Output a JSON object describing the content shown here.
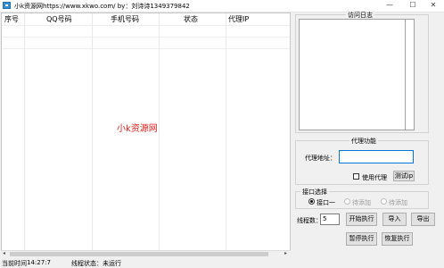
{
  "window": {
    "title": "小k资源网https://www.xkwo.com/  by：刘诗诗1349379842",
    "minimize_glyph": "—",
    "maximize_glyph": "☐",
    "close_glyph": "✕"
  },
  "table": {
    "columns": [
      "序号",
      "QQ号码",
      "手机号码",
      "状态",
      "代理IP"
    ],
    "rows": []
  },
  "watermark": "小k资源网",
  "scrollbar": {
    "left_arrow": "◂",
    "right_arrow": "▸"
  },
  "status_bar": {
    "time_label": "当前时间",
    "time_value": "14:27:7",
    "thread_status": "线程状态：未运行"
  },
  "log_panel": {
    "title": "访问日志"
  },
  "proxy_panel": {
    "title": "代理功能",
    "address_label": "代理地址：",
    "address_value": "",
    "use_proxy_label": "使用代理",
    "use_proxy_checked": false,
    "test_button": "测试ip"
  },
  "interface_panel": {
    "title": "接口选择",
    "options": [
      {
        "label": "接口一",
        "selected": true,
        "enabled": true
      },
      {
        "label": "待添加",
        "selected": false,
        "enabled": false
      },
      {
        "label": "待添加",
        "selected": false,
        "enabled": false
      }
    ]
  },
  "controls": {
    "thread_label": "线程数：",
    "thread_value": "5",
    "start_button": "开始执行",
    "import_button": "导入",
    "export_button": "导出",
    "pause_button": "暂停执行",
    "resume_button": "恢复执行"
  },
  "colors": {
    "watermark": "#e0201c",
    "focus_border": "#0078d7"
  }
}
